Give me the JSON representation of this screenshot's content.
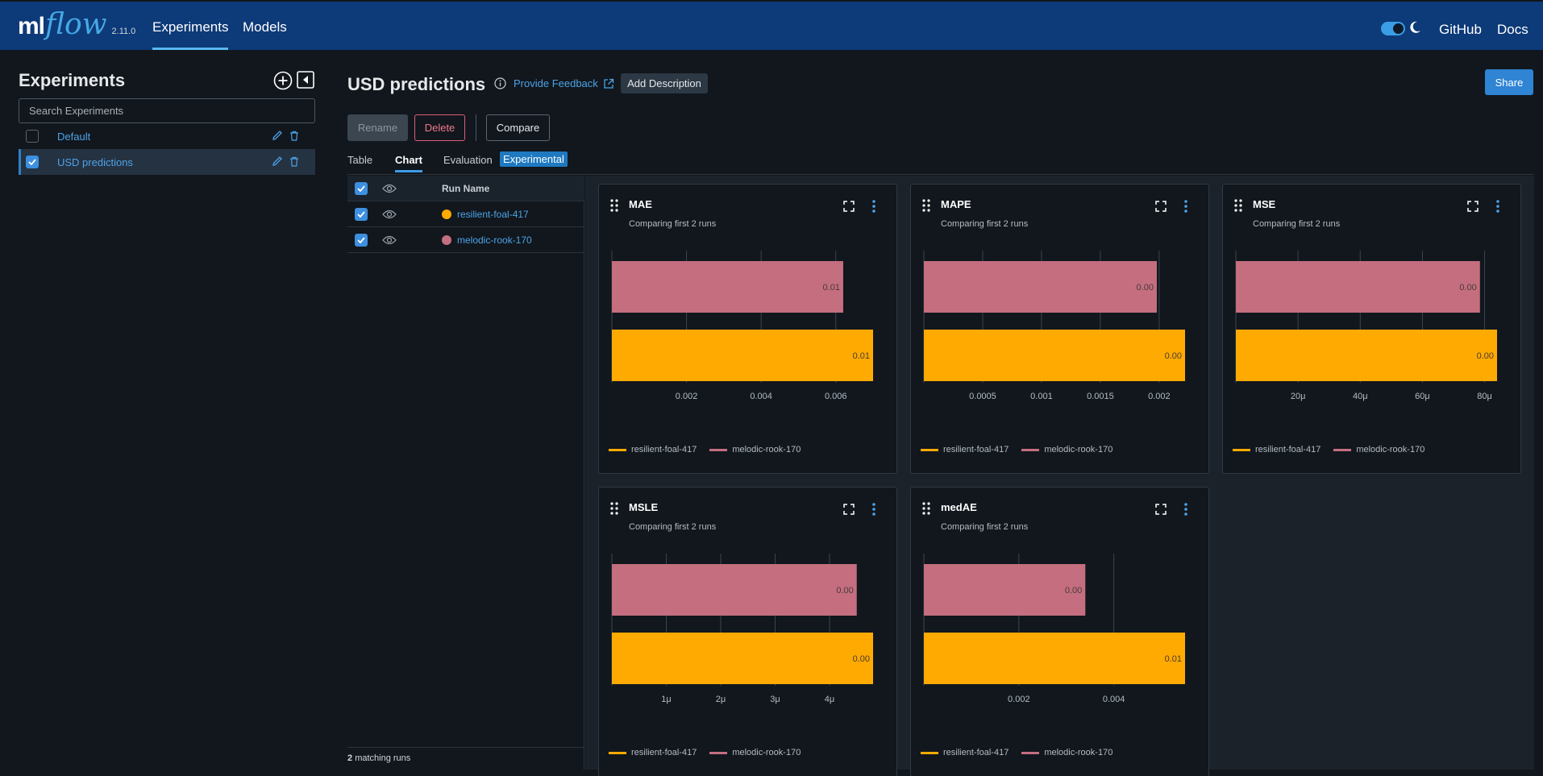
{
  "header": {
    "logo_ml": "ml",
    "logo_flow": "flow",
    "version": "2.11.0",
    "nav": [
      "Experiments",
      "Models"
    ],
    "links": [
      "GitHub",
      "Docs"
    ]
  },
  "sidebar": {
    "title": "Experiments",
    "search_placeholder": "Search Experiments",
    "experiments": [
      {
        "name": "Default",
        "checked": false
      },
      {
        "name": "USD predictions",
        "checked": true
      }
    ]
  },
  "main": {
    "title": "USD predictions",
    "feedback": "Provide Feedback",
    "add_description": "Add Description",
    "share": "Share",
    "rename": "Rename",
    "delete": "Delete",
    "compare": "Compare",
    "tabs": [
      "Table",
      "Chart",
      "Evaluation"
    ],
    "active_tab": "Chart",
    "experimental_badge": "Experimental",
    "run_table": {
      "header": "Run Name",
      "runs": [
        {
          "name": "resilient-foal-417",
          "color": "#ffaa00"
        },
        {
          "name": "melodic-rook-170",
          "color": "#c46e80"
        }
      ],
      "footer_count": "2",
      "footer_label": "matching runs"
    }
  },
  "colors": {
    "accent": "#4da3e8",
    "series_a": "#ffaa00",
    "series_b": "#c46e80"
  },
  "chart_data": [
    {
      "type": "bar",
      "title": "MAE",
      "subtitle": "Comparing first 2 runs",
      "orientation": "horizontal",
      "categories": [
        "melodic-rook-170",
        "resilient-foal-417"
      ],
      "values": [
        0.0062,
        0.007
      ],
      "data_labels": [
        "0.01",
        "0.01"
      ],
      "xlim": [
        0,
        0.007
      ],
      "ticks": [
        0.002,
        0.004,
        0.006
      ],
      "tick_labels": [
        "0.002",
        "0.004",
        "0.006"
      ],
      "legend": [
        "resilient-foal-417",
        "melodic-rook-170"
      ]
    },
    {
      "type": "bar",
      "title": "MAPE",
      "subtitle": "Comparing first 2 runs",
      "orientation": "horizontal",
      "categories": [
        "melodic-rook-170",
        "resilient-foal-417"
      ],
      "values": [
        0.00198,
        0.00222
      ],
      "data_labels": [
        "0.00",
        "0.00"
      ],
      "xlim": [
        0,
        0.00222
      ],
      "ticks": [
        0.0005,
        0.001,
        0.0015,
        0.002
      ],
      "tick_labels": [
        "0.0005",
        "0.001",
        "0.0015",
        "0.002"
      ],
      "legend": [
        "resilient-foal-417",
        "melodic-rook-170"
      ]
    },
    {
      "type": "bar",
      "title": "MSE",
      "subtitle": "Comparing first 2 runs",
      "orientation": "horizontal",
      "categories": [
        "melodic-rook-170",
        "resilient-foal-417"
      ],
      "values": [
        7.85e-05,
        8.4e-05
      ],
      "data_labels": [
        "0.00",
        "0.00"
      ],
      "xlim": [
        0,
        8.4e-05
      ],
      "ticks": [
        2e-05,
        4e-05,
        6e-05,
        8e-05
      ],
      "tick_labels": [
        "20μ",
        "40μ",
        "60μ",
        "80μ"
      ],
      "legend": [
        "resilient-foal-417",
        "melodic-rook-170"
      ]
    },
    {
      "type": "bar",
      "title": "MSLE",
      "subtitle": "Comparing first 2 runs",
      "orientation": "horizontal",
      "categories": [
        "melodic-rook-170",
        "resilient-foal-417"
      ],
      "values": [
        4.5e-06,
        4.8e-06
      ],
      "data_labels": [
        "0.00",
        "0.00"
      ],
      "xlim": [
        0,
        4.8e-06
      ],
      "ticks": [
        1e-06,
        2e-06,
        3e-06,
        4e-06
      ],
      "tick_labels": [
        "1μ",
        "2μ",
        "3μ",
        "4μ"
      ],
      "legend": [
        "resilient-foal-417",
        "melodic-rook-170"
      ]
    },
    {
      "type": "bar",
      "title": "medAE",
      "subtitle": "Comparing first 2 runs",
      "orientation": "horizontal",
      "categories": [
        "melodic-rook-170",
        "resilient-foal-417"
      ],
      "values": [
        0.0034,
        0.0055
      ],
      "data_labels": [
        "0.00",
        "0.01"
      ],
      "xlim": [
        0,
        0.0055
      ],
      "ticks": [
        0.002,
        0.004
      ],
      "tick_labels": [
        "0.002",
        "0.004"
      ],
      "legend": [
        "resilient-foal-417",
        "melodic-rook-170"
      ]
    }
  ]
}
